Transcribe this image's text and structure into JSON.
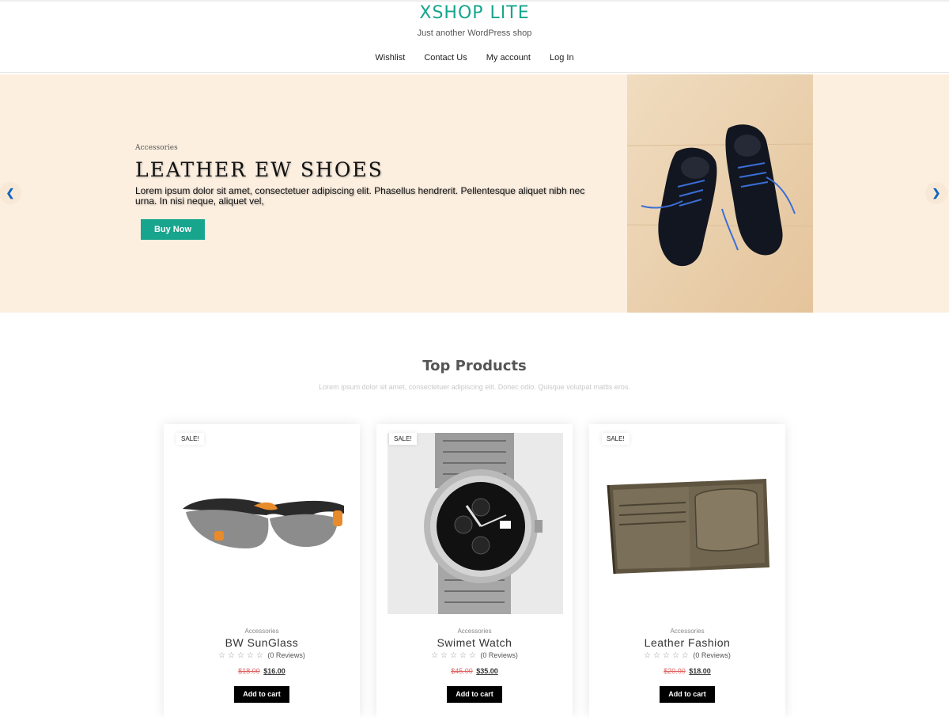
{
  "header": {
    "site_title": "XSHOP LITE",
    "tagline": "Just another WordPress shop",
    "nav": [
      "Wishlist",
      "Contact Us",
      "My account",
      "Log In"
    ],
    "accent_color": "#17a58d"
  },
  "hero": {
    "category": "Accessories",
    "title": "LEATHER EW SHOES",
    "description": "Lorem ipsum dolor sit amet, consectetuer adipiscing elit. Phasellus hendrerit. Pellentesque aliquet nibh nec urna. In nisi neque, aliquet vel,",
    "button": "Buy Now",
    "prev_icon": "chevron-left-icon",
    "next_icon": "chevron-right-icon",
    "background": "#fcefe0"
  },
  "products_section": {
    "title": "Top Products",
    "subtitle": "Lorem ipsum dolor sit amet, consectetuer adipiscing elit. Donec odio. Quisque volutpat mattis eros."
  },
  "products": [
    {
      "badge": "SALE!",
      "category": "Accessories",
      "name": "BW SunGlass",
      "reviews": "(0 Reviews)",
      "old_price": "$18.00",
      "price": "$16.00",
      "button": "Add to cart"
    },
    {
      "badge": "SALE!",
      "category": "Accessories",
      "name": "Swimet Watch",
      "reviews": "(0 Reviews)",
      "old_price": "$45.00",
      "price": "$35.00",
      "button": "Add to cart"
    },
    {
      "badge": "SALE!",
      "category": "Accessories",
      "name": "Leather Fashion",
      "reviews": "(0 Reviews)",
      "old_price": "$20.00",
      "price": "$18.00",
      "button": "Add to cart"
    }
  ],
  "stars": "☆☆☆☆☆"
}
